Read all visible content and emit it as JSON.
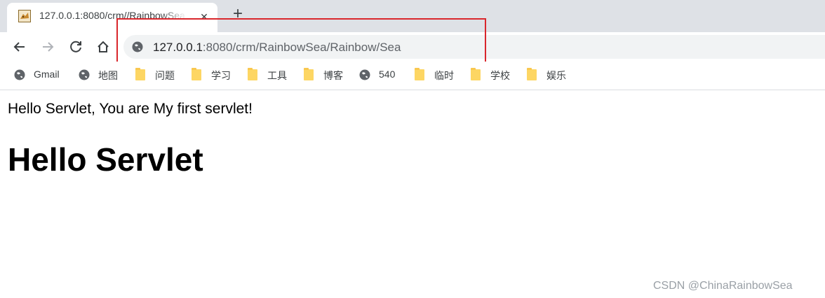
{
  "browser": {
    "tab": {
      "title": "127.0.0.1:8080/crm//RainbowSea",
      "close_glyph": "✕",
      "favicon_icon": "tomcat-favicon-icon"
    },
    "new_tab_glyph": "+",
    "address_bar": {
      "host": "127.0.0.1",
      "rest": ":8080/crm/RainbowSea/Rainbow/Sea",
      "icon": "globe-icon",
      "highlight_color": "#d9262c"
    },
    "bookmarks": [
      {
        "label": "Gmail",
        "icon": "globe-icon"
      },
      {
        "label": "地图",
        "icon": "globe-icon"
      },
      {
        "label": "问题",
        "icon": "folder-icon"
      },
      {
        "label": "学习",
        "icon": "folder-icon"
      },
      {
        "label": "工具",
        "icon": "folder-icon"
      },
      {
        "label": "博客",
        "icon": "folder-icon"
      },
      {
        "label": "540",
        "icon": "globe-icon"
      },
      {
        "label": "临时",
        "icon": "folder-icon"
      },
      {
        "label": "学校",
        "icon": "folder-icon"
      },
      {
        "label": "娱乐",
        "icon": "folder-icon"
      }
    ]
  },
  "page": {
    "text": "Hello Servlet, You are My first servlet!",
    "heading": "Hello Servlet"
  },
  "watermark": "CSDN @ChinaRainbowSea"
}
